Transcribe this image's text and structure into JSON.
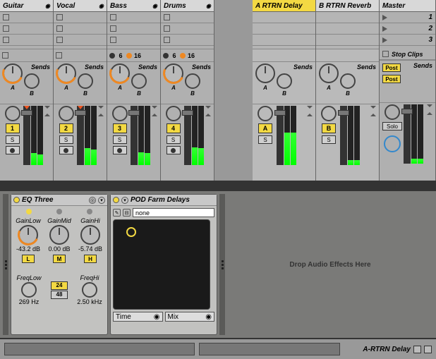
{
  "tracks": [
    {
      "name": "Guitar",
      "number": "1",
      "meter_h": "20%"
    },
    {
      "name": "Vocal",
      "number": "2",
      "meter_h": "28%"
    },
    {
      "name": "Bass",
      "number": "3",
      "meter_h": "22%"
    },
    {
      "name": "Drums",
      "number": "4",
      "meter_h": "30%"
    }
  ],
  "io": {
    "ch1": "6",
    "ch2": "16"
  },
  "returns": [
    {
      "name": "A RTRN Delay",
      "letter": "A",
      "selected": true
    },
    {
      "name": "B RTRN Reverb",
      "letter": "B",
      "selected": false
    }
  ],
  "master": {
    "name": "Master",
    "scenes": [
      "1",
      "2",
      "3"
    ],
    "stop_label": "Stop Clips",
    "solo_label": "Solo",
    "post_label": "Post"
  },
  "labels": {
    "sends": "Sends",
    "solo": "S",
    "send_a": "A",
    "send_b": "B"
  },
  "eq": {
    "title": "EQ Three",
    "gain_low_lbl": "GainLow",
    "gain_low_val": "-43.2 dB",
    "gain_mid_lbl": "GainMid",
    "gain_mid_val": "0.00 dB",
    "gain_hi_lbl": "GainHi",
    "gain_hi_val": "-5.74 dB",
    "low_btn": "L",
    "mid_btn": "M",
    "hi_btn": "H",
    "freq_low_lbl": "FreqLow",
    "freq_low_val": "269 Hz",
    "freq_hi_lbl": "FreqHi",
    "freq_hi_val": "2.50 kHz",
    "btn24": "24",
    "btn48": "48"
  },
  "pod": {
    "title": "POD Farm Delays",
    "preset": "none",
    "param_time": "Time",
    "param_mix": "Mix"
  },
  "drop_text": "Drop Audio Effects Here",
  "status": {
    "device_name": "A-RTRN Delay"
  }
}
